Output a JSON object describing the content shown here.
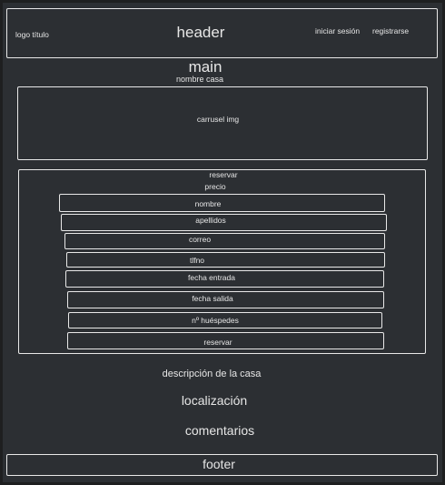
{
  "header": {
    "logo": "logo título",
    "title": "header",
    "login": "iniciar sesión",
    "register": "registrarse"
  },
  "main": {
    "title": "main",
    "house_name": "nombre casa",
    "carousel": "carrusel img",
    "booking": {
      "title": "reservar",
      "price": "precio",
      "fields": [
        "nombre",
        "apellidos",
        "correo",
        "tlfno",
        "fecha entrada",
        "fecha salida",
        "nº huéspedes"
      ],
      "submit": "reservar"
    },
    "description": "descripción de la casa",
    "location": "localización",
    "comments": "comentarios"
  },
  "footer": {
    "label": "footer"
  }
}
